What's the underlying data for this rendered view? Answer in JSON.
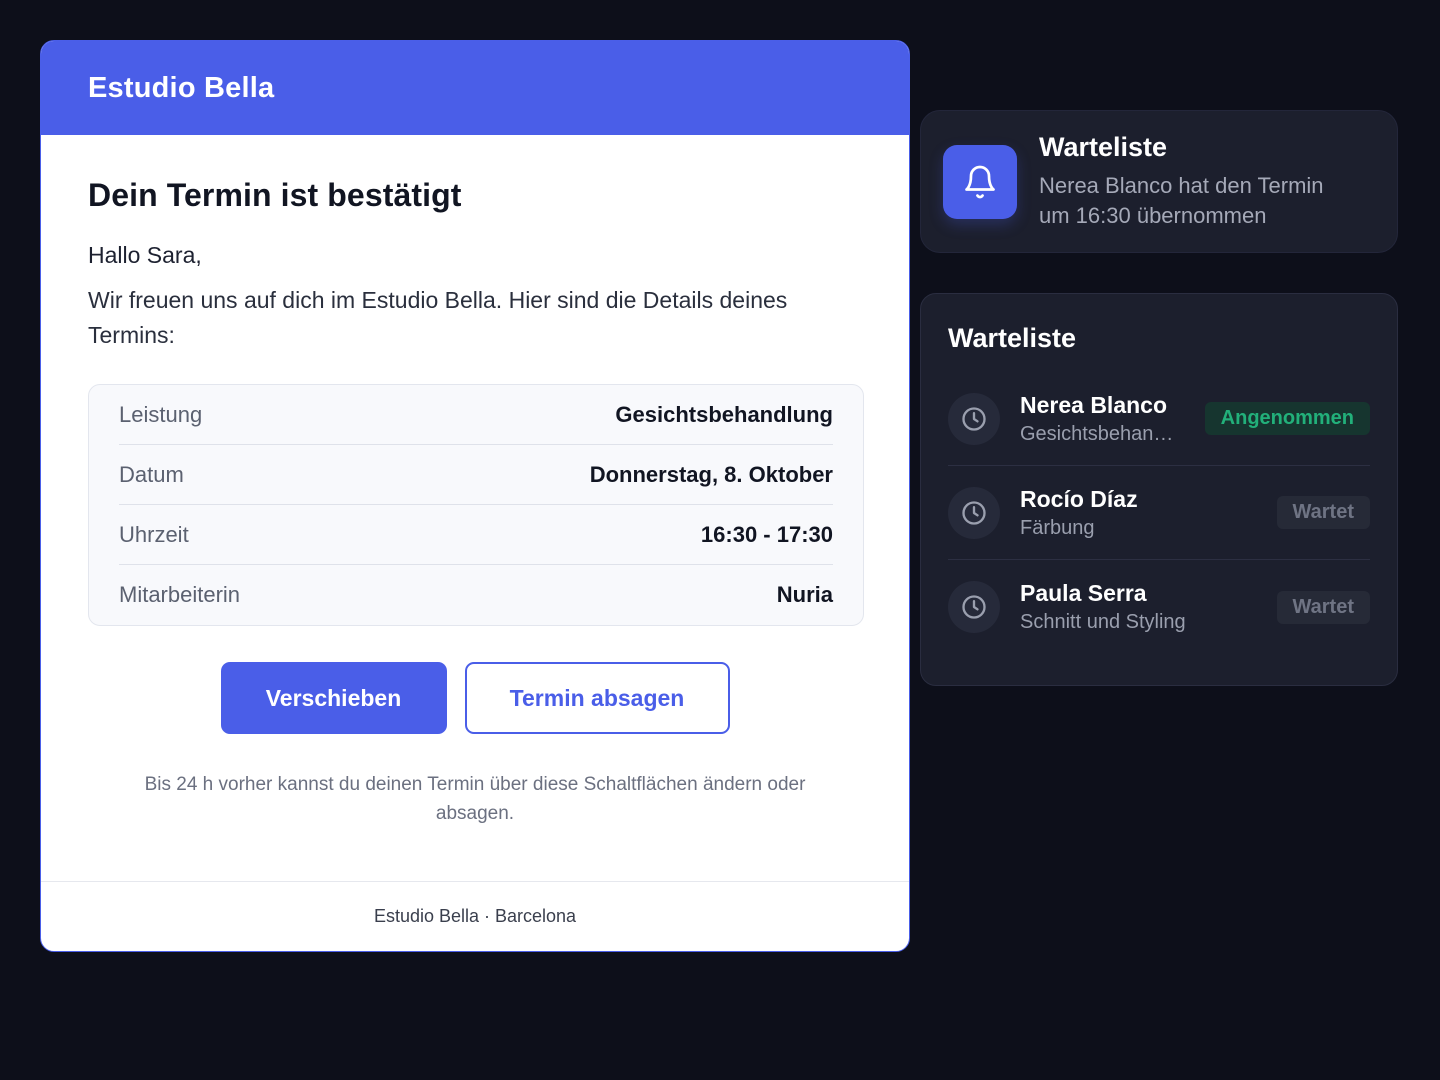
{
  "email": {
    "brand": "Estudio Bella",
    "headline": "Dein Termin ist bestätigt",
    "greeting": "Hallo Sara,",
    "intro": "Wir freuen uns auf dich im Estudio Bella. Hier sind die Details deines Termins:",
    "details": [
      {
        "label": "Leistung",
        "value": "Gesichtsbehandlung"
      },
      {
        "label": "Datum",
        "value": "Donnerstag, 8. Oktober"
      },
      {
        "label": "Uhrzeit",
        "value": "16:30 - 17:30"
      },
      {
        "label": "Mitarbeiterin",
        "value": "Nuria"
      }
    ],
    "buttons": {
      "reschedule": "Verschieben",
      "cancel": "Termin absagen"
    },
    "hint": "Bis 24 h vorher kannst du deinen Termin über diese Schaltflächen ändern oder absagen.",
    "footer": "Estudio Bella · Barcelona"
  },
  "toast": {
    "icon": "bell-icon",
    "title": "Warteliste",
    "message": "Nerea Blanco hat den Termin um 16:30 übernommen"
  },
  "waitlist": {
    "title": "Warteliste",
    "items": [
      {
        "name": "Nerea Blanco",
        "service": "Gesichtsbehandlung",
        "status": "Angenommen",
        "icon": "clock-icon"
      },
      {
        "name": "Rocío Díaz",
        "service": "Färbung",
        "status": "Wartet",
        "icon": "clock-icon"
      },
      {
        "name": "Paula Serra",
        "service": "Schnitt und Styling",
        "status": "Wartet",
        "icon": "clock-icon"
      }
    ]
  },
  "colors": {
    "accent": "#4a5ee8",
    "background": "#0d0f1a",
    "panel": "#1c1f2d",
    "accepted": "#22b07a",
    "waiting": "#6f7484"
  }
}
